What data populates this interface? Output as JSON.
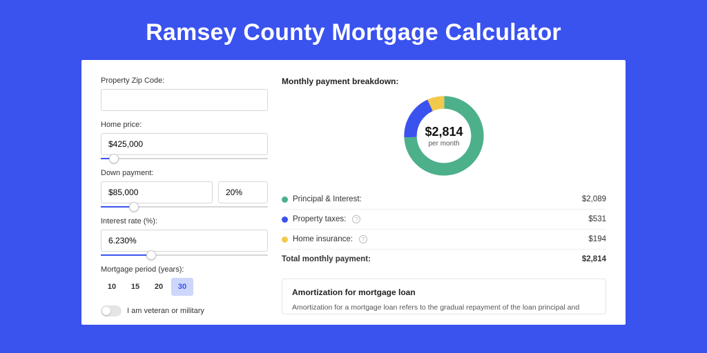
{
  "title": "Ramsey County Mortgage Calculator",
  "form": {
    "zip_label": "Property Zip Code:",
    "zip_value": "",
    "home_price_label": "Home price:",
    "home_price_value": "$425,000",
    "home_price_slider_pct": 8,
    "down_payment_label": "Down payment:",
    "down_payment_value": "$85,000",
    "down_payment_pct": "20%",
    "down_payment_slider_pct": 20,
    "rate_label": "Interest rate (%):",
    "rate_value": "6.230%",
    "rate_slider_pct": 30,
    "period_label": "Mortgage period (years):",
    "period_options": [
      "10",
      "15",
      "20",
      "30"
    ],
    "period_active_index": 3,
    "veteran_label": "I am veteran or military"
  },
  "breakdown": {
    "heading": "Monthly payment breakdown:",
    "total": "$2,814",
    "per_month": "per month",
    "items": [
      {
        "label": "Principal & Interest:",
        "value": "$2,089",
        "color": "#4cb08a",
        "has_info": false
      },
      {
        "label": "Property taxes:",
        "value": "$531",
        "color": "#3a52ee",
        "has_info": true
      },
      {
        "label": "Home insurance:",
        "value": "$194",
        "color": "#f2c94c",
        "has_info": true
      }
    ],
    "total_row_label": "Total monthly payment:",
    "total_row_value": "$2,814"
  },
  "amort": {
    "heading": "Amortization for mortgage loan",
    "desc": "Amortization for a mortgage loan refers to the gradual repayment of the loan principal and interest over a specified"
  },
  "chart_data": {
    "type": "pie",
    "title": "Monthly payment breakdown",
    "categories": [
      "Principal & Interest",
      "Property taxes",
      "Home insurance"
    ],
    "values": [
      2089,
      531,
      194
    ],
    "colors": [
      "#4cb08a",
      "#3a52ee",
      "#f2c94c"
    ],
    "total": 2814,
    "center_label": "$2,814",
    "center_sublabel": "per month",
    "donut": true
  }
}
